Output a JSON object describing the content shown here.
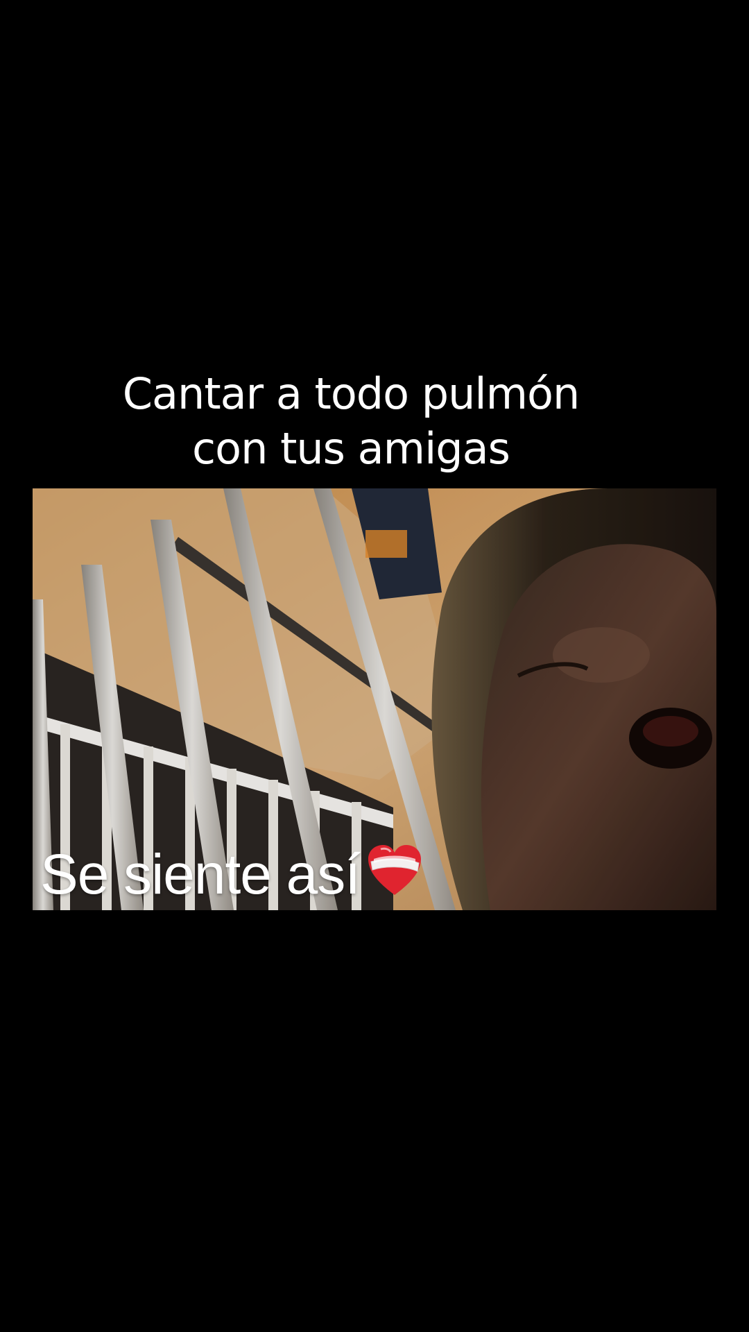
{
  "caption": {
    "line1": "Cantar a todo pulmón",
    "line2": "con tus amigas"
  },
  "video": {
    "overlay_text": "Se siente así",
    "overlay_emoji": "mending-heart-icon"
  },
  "colors": {
    "background": "#000000",
    "text": "#ffffff",
    "heart": "#e0242f"
  }
}
